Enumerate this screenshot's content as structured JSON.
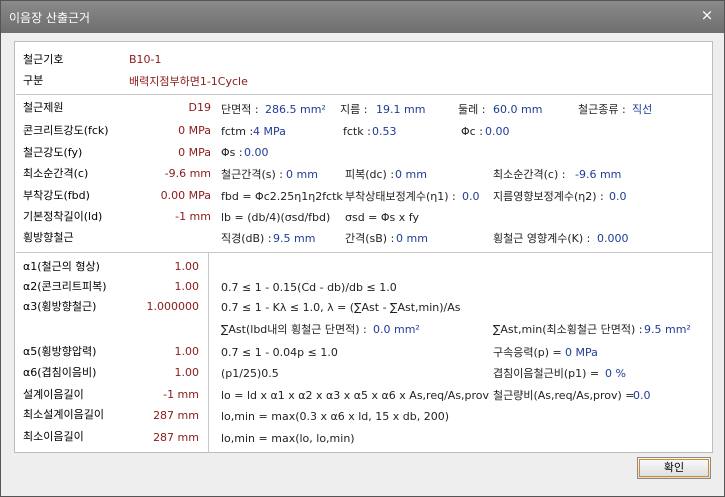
{
  "window": {
    "title": "이음장 산출근거",
    "close_icon": "×"
  },
  "header": {
    "rows": [
      {
        "label": "철근기호",
        "value": "B10-1"
      },
      {
        "label": "구분",
        "value": "배력지점부하면1-1Cycle"
      }
    ]
  },
  "section1": {
    "left": [
      {
        "label": "철근제원",
        "value": "D19"
      },
      {
        "label": "콘크리트강도(fck)",
        "value": "0 MPa"
      },
      {
        "label": "철근강도(fy)",
        "value": "0 MPa"
      },
      {
        "label": "최소순간격(c)",
        "value": "-9.6 mm"
      },
      {
        "label": "부착강도(fbd)",
        "value": "0.00 MPa"
      },
      {
        "label": "기본정착길이(ld)",
        "value": "-1 mm"
      },
      {
        "label": "횡방향철근",
        "value": ""
      }
    ],
    "r1": {
      "a_l": "단면적 :",
      "a_v": "286.5 mm²",
      "b_l": "지름 :",
      "b_v": "19.1 mm",
      "c_l": "둘레 :",
      "c_v": "60.0 mm",
      "d_l": "철근종류 :",
      "d_v": "직선"
    },
    "r2": {
      "a_l": "fctm :",
      "a_v": "4 MPa",
      "b_l": "fctk :",
      "b_v": "0.53",
      "c_l": "Φc :",
      "c_v": "0.00"
    },
    "r3": {
      "a_l": "Φs :",
      "a_v": "0.00"
    },
    "r4": {
      "a_l": "철근간격(s) :",
      "a_v": "0 mm",
      "b_l": "피복(dc) :",
      "b_v": "0 mm",
      "c_l": "최소순간격(c) :",
      "c_v": "-9.6 mm"
    },
    "r5": {
      "a": "fbd = Φc2.25η1η2fctk",
      "b_l": "부착상태보정계수(η1) :",
      "b_v": "0.0",
      "c_l": "지름영향보정계수(η2) :",
      "c_v": "0.0"
    },
    "r6": {
      "a": "lb = (db/4)(σsd/fbd)",
      "b": "σsd = Φs x fy"
    },
    "r7": {
      "a_l": "직경(dB) :",
      "a_v": "9.5 mm",
      "b_l": "간격(sB) :",
      "b_v": "0 mm",
      "c_l": "횡철근 영향계수(K) :",
      "c_v": "0.000"
    }
  },
  "section2": {
    "left": [
      {
        "label": "α1(철근의 형상)",
        "value": "1.00"
      },
      {
        "label": "α2(콘크리트피복)",
        "value": "1.00"
      },
      {
        "label": "α3(횡방향철근)",
        "value": "1.000000"
      },
      {
        "label": "",
        "value": ""
      },
      {
        "label": "α5(횡방향압력)",
        "value": "1.00"
      },
      {
        "label": "α6(겹침이음비)",
        "value": "1.00"
      },
      {
        "label": "설계이음길이",
        "value": "-1 mm"
      },
      {
        "label": "최소설계이음길이",
        "value": "287 mm"
      },
      {
        "label": "최소이음길이",
        "value": "287 mm"
      }
    ],
    "f1": "0.7 ≤ 1 - 0.15(Cd - db)/db ≤ 1.0",
    "f2": "0.7 ≤ 1 - Kλ ≤ 1.0, λ = (∑Ast - ∑Ast,min)/As",
    "f3": {
      "a_l": "∑Ast(lbd내의 횡철근 단면적) :",
      "a_v": "0.0 mm²",
      "b_l": "∑Ast,min(최소횡철근 단면적) :",
      "b_v": "9.5 mm²"
    },
    "f4": {
      "a": "0.7 ≤ 1 - 0.04p ≤ 1.0",
      "b_l": "구속응력(p) =",
      "b_v": "0 MPa"
    },
    "f5": {
      "a": "(p1/25)0.5",
      "b_l": "겹침이음철근비(p1) =",
      "b_v": "0 %"
    },
    "f6": {
      "a": "lo = ld x α1 x α2 x α3 x α5 x α6 x As,req/As,prov",
      "b_l": "철근량비(As,req/As,prov) =",
      "b_v": "0.0"
    },
    "f7": "lo,min = max(0.3 x α6 x ld, 15 x db, 200)",
    "f8": "lo,min = max(lo, lo,min)"
  },
  "footer": {
    "ok_label": "확인"
  }
}
